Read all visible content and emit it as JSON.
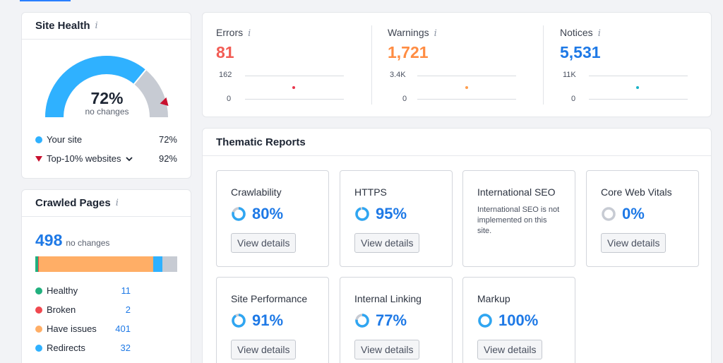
{
  "site_health": {
    "title": "Site Health",
    "info_icon": "i",
    "percent": "72%",
    "change": "no changes",
    "rows": [
      {
        "label": "Your site",
        "value": "72%"
      },
      {
        "label": "Top-10% websites",
        "value": "92%"
      }
    ],
    "colors": {
      "your_site": "#2fb1ff",
      "top10": "#c8102e",
      "gray": "#c7cbd3"
    },
    "gauge": {
      "your_site_fraction": 0.72,
      "top10_fraction": 0.92
    }
  },
  "crawled_pages": {
    "title": "Crawled Pages",
    "info_icon": "i",
    "count": "498",
    "change": "no changes",
    "bar_fractions": {
      "healthy": 0.022,
      "broken": 0.004,
      "have_issues": 0.805,
      "redirects": 0.064,
      "blocked": 0.105
    },
    "items": [
      {
        "label": "Healthy",
        "value": "11",
        "color": "#21b07e"
      },
      {
        "label": "Broken",
        "value": "2",
        "color": "#f0484f"
      },
      {
        "label": "Have issues",
        "value": "401",
        "color": "#ffae66"
      },
      {
        "label": "Redirects",
        "value": "32",
        "color": "#2fb1ff"
      }
    ]
  },
  "issues": [
    {
      "label": "Errors",
      "value": "81",
      "color": "#f25c54",
      "axis_top": "162",
      "axis_bottom": "0"
    },
    {
      "label": "Warnings",
      "value": "1,721",
      "color": "#ff8c42",
      "axis_top": "3.4K",
      "axis_bottom": "0"
    },
    {
      "label": "Notices",
      "value": "5,531",
      "color": "#1e79e6",
      "axis_top": "11K",
      "axis_bottom": "0"
    }
  ],
  "issue_dot_colors": [
    "#e8364c",
    "#ff9d4d",
    "#19b3c7"
  ],
  "thematic": {
    "title": "Thematic Reports",
    "tiles": [
      {
        "title": "Crawlability",
        "value": "80%",
        "fraction": 0.8,
        "button": "View details"
      },
      {
        "title": "HTTPS",
        "value": "95%",
        "fraction": 0.95,
        "button": "View details"
      },
      {
        "title": "International SEO",
        "note": "International SEO is not implemented on this site."
      },
      {
        "title": "Core Web Vitals",
        "value": "0%",
        "fraction": 0,
        "button": "View details"
      },
      {
        "title": "Site Performance",
        "value": "91%",
        "fraction": 0.91,
        "button": "View details"
      },
      {
        "title": "Internal Linking",
        "value": "77%",
        "fraction": 0.77,
        "button": "View details"
      },
      {
        "title": "Markup",
        "value": "100%",
        "fraction": 1.0,
        "button": "View details"
      }
    ],
    "ring_color": "#2fa6f2",
    "ring_track": "#c7cbd3"
  }
}
